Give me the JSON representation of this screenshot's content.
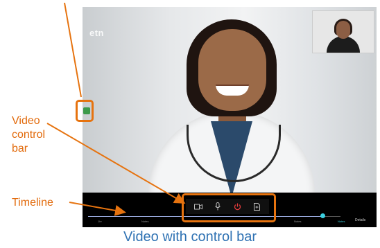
{
  "video": {
    "watermark": "etn"
  },
  "controls": {
    "buttons": [
      {
        "icon": "camera-icon",
        "label": "Camera"
      },
      {
        "icon": "microphone-icon",
        "label": "Microphone"
      },
      {
        "icon": "power-icon",
        "label": "End call",
        "color": "#e23b3b"
      },
      {
        "icon": "document-icon",
        "label": "Notes"
      }
    ]
  },
  "timeline": {
    "ticks": [
      "1hr",
      "Notes",
      "Video",
      "Notes",
      "Notes"
    ],
    "active_tick": "Notes",
    "end_label": "Details",
    "progress": 0.93
  },
  "annotations": {
    "video_control_bar": "Video control bar",
    "timeline": "Timeline",
    "caption": "Video with control bar"
  },
  "colors": {
    "annotation": "#e6730f",
    "caption": "#2f72b3",
    "timeline_accent": "#3bd0e0"
  }
}
